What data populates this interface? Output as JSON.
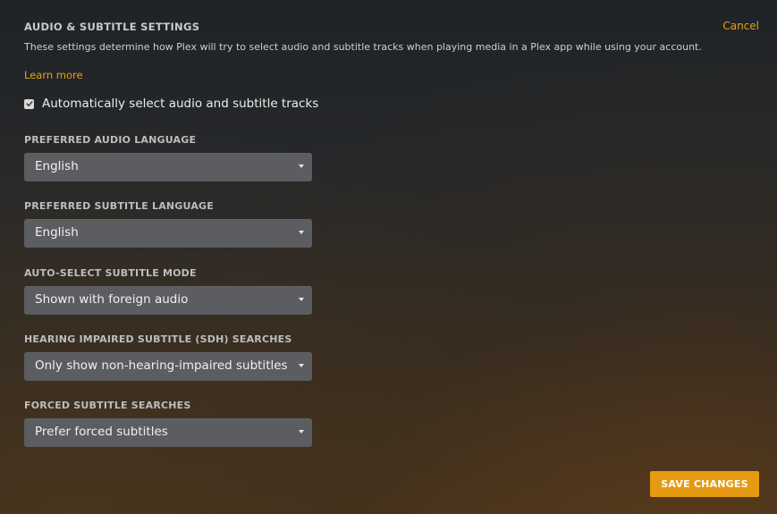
{
  "header": {
    "title": "AUDIO & SUBTITLE SETTINGS",
    "cancel_label": "Cancel",
    "description": "These settings determine how Plex will try to select audio and subtitle tracks when playing media in a Plex app while using your account.",
    "learn_more_label": "Learn more"
  },
  "auto_select": {
    "label": "Automatically select audio and subtitle tracks",
    "checked": true
  },
  "fields": [
    {
      "label": "PREFERRED AUDIO LANGUAGE",
      "value": "English"
    },
    {
      "label": "PREFERRED SUBTITLE LANGUAGE",
      "value": "English"
    },
    {
      "label": "AUTO-SELECT SUBTITLE MODE",
      "value": "Shown with foreign audio"
    },
    {
      "label": "HEARING IMPAIRED SUBTITLE (SDH) SEARCHES",
      "value": "Only show non-hearing-impaired subtitles"
    },
    {
      "label": "FORCED SUBTITLE SEARCHES",
      "value": "Prefer forced subtitles"
    }
  ],
  "footer": {
    "save_label": "SAVE CHANGES"
  },
  "colors": {
    "accent": "#e5a00d",
    "select_bg": "#5b5d60"
  },
  "icons": {
    "checkbox": "check-icon",
    "dropdown": "caret-down-icon"
  }
}
